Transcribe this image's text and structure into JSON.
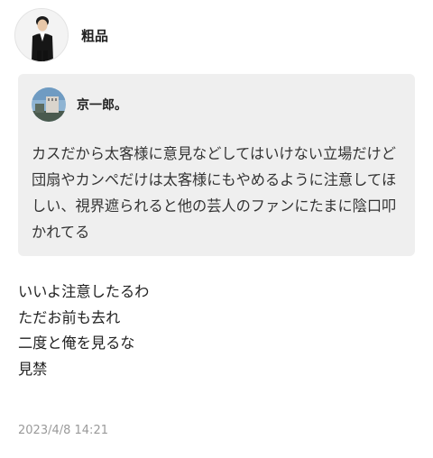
{
  "post": {
    "author": "粗品",
    "lines": [
      "いいよ注意したるわ",
      "ただお前も去れ",
      "二度と俺を見るな",
      "見禁"
    ],
    "timestamp": "2023/4/8 14:21"
  },
  "quoted_message": {
    "author": "京一郎。",
    "text": "カスだから太客様に意見などしてはいけない立場だけど団扇やカンペだけは太客様にもやめるように注意してほしい、視界遮られると他の芸人のファンにたまに陰口叩かれてる"
  },
  "colors": {
    "quote_background": "#efefef",
    "timestamp": "#9a9a9a"
  }
}
